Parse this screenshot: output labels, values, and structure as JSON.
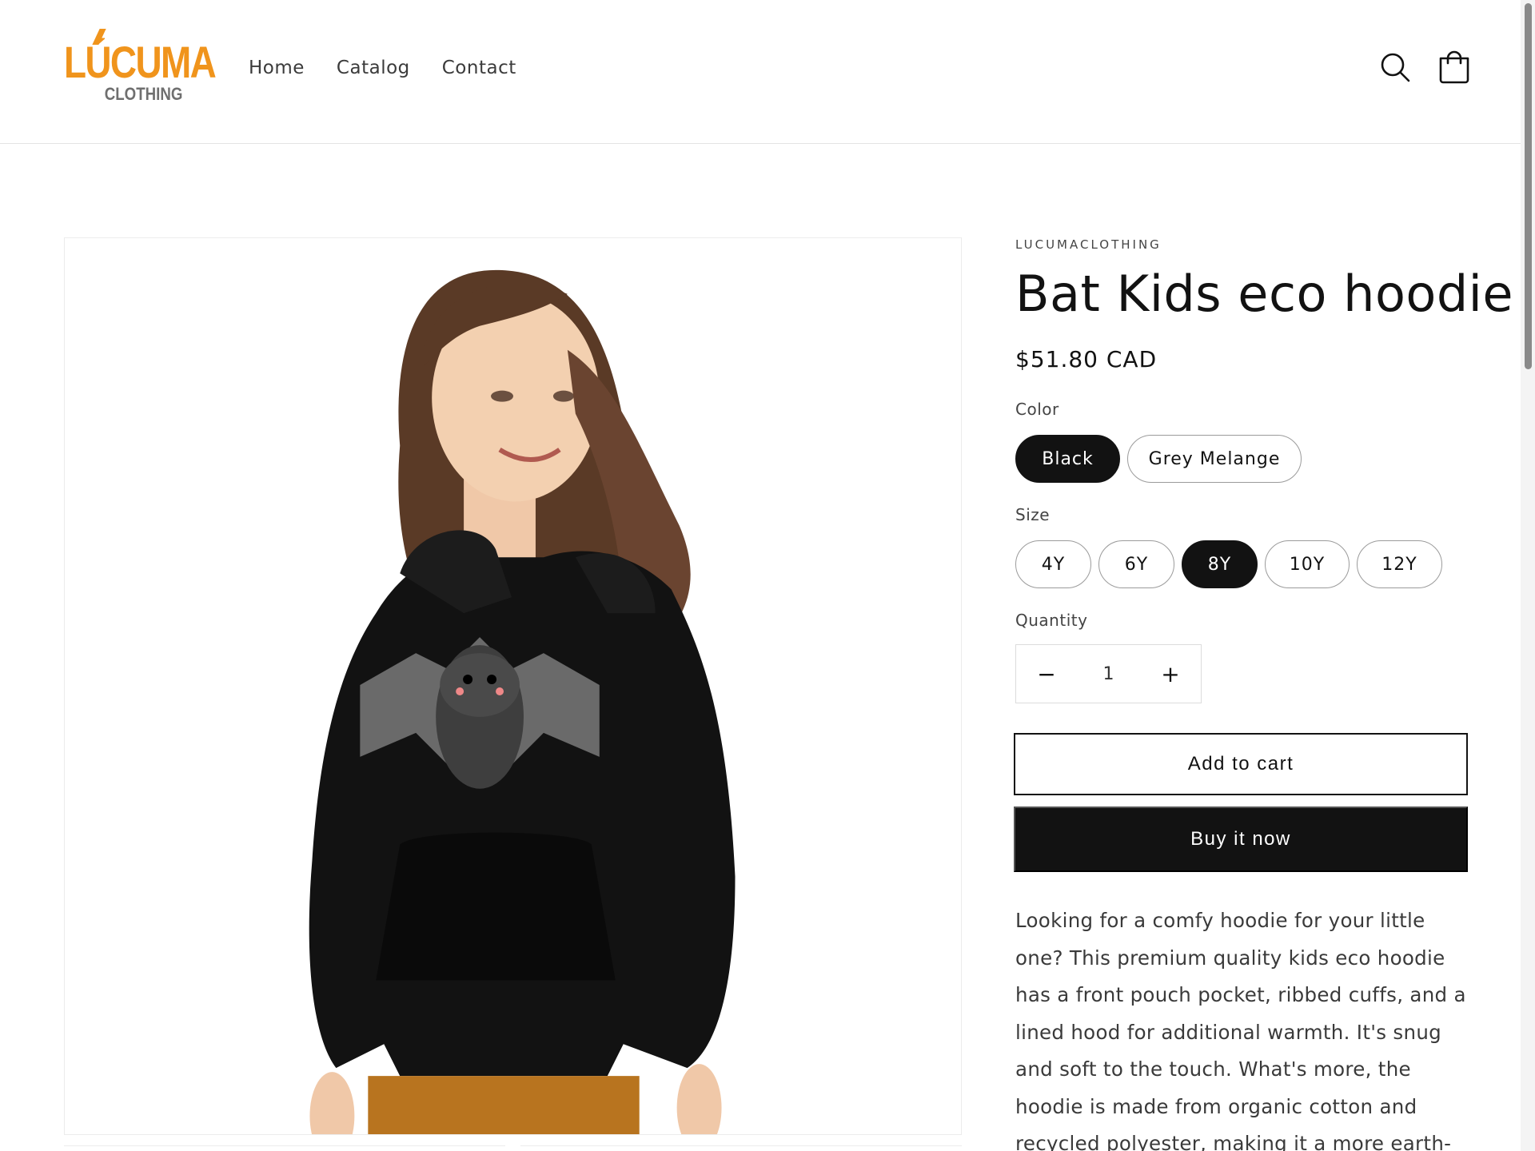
{
  "header": {
    "logo": {
      "brand": "LÚCUMA",
      "sub": "CLOTHING"
    },
    "nav": [
      "Home",
      "Catalog",
      "Contact"
    ],
    "icons": {
      "search": "search-icon",
      "cart": "cart-icon"
    }
  },
  "product": {
    "vendor": "LUCUMACLOTHING",
    "title": "Bat Kids eco hoodie",
    "price": "$51.80 CAD",
    "color_label": "Color",
    "colors": [
      "Black",
      "Grey Melange"
    ],
    "selected_color": "Black",
    "size_label": "Size",
    "sizes": [
      "4Y",
      "6Y",
      "8Y",
      "10Y",
      "12Y"
    ],
    "selected_size": "8Y",
    "quantity_label": "Quantity",
    "quantity": "1",
    "decrement": "−",
    "increment": "+",
    "add_to_cart": "Add to cart",
    "buy_now": "Buy it now",
    "description": "Looking for a comfy hoodie for your little one? This premium quality kids eco hoodie has a front pouch pocket, ribbed cuffs, and a lined hood for additional warmth. It's snug and soft to the touch. What's more, the hoodie is made from organic cotton and recycled polyester, making it a more earth-friendly fashion choice!"
  },
  "colors": {
    "brand_orange": "#f0941c",
    "logo_grey": "#6f6f6f",
    "primary": "#121212",
    "hoodie": "#121212",
    "pants": "#b8741f"
  }
}
